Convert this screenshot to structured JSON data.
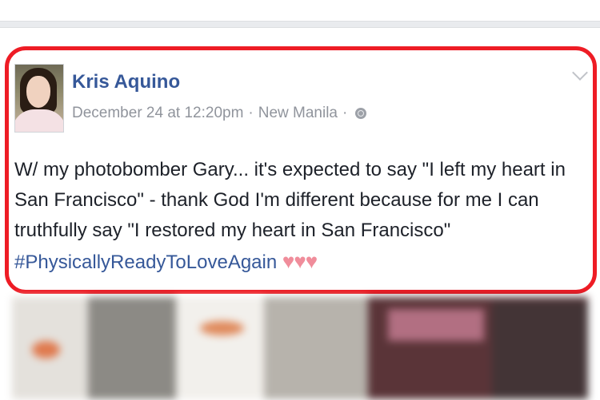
{
  "post": {
    "author": "Kris Aquino",
    "date": "December 24 at 12:20pm",
    "meta_separator": "·",
    "location": "New Manila",
    "privacy_icon": "globe-icon",
    "text": "W/ my photobomber Gary... it's expected to say \"I left my heart in San Francisco\" - thank God I'm different because for me I can truthfully say \"I restored my heart in San Francisco\"",
    "hashtag": "#PhysicallyReadyToLoveAgain",
    "hearts": "♥♥♥"
  },
  "colors": {
    "highlight_border": "#ee1c25",
    "author_link": "#365899",
    "meta_text": "#90949c",
    "body_text": "#1d2129",
    "heart": "#f08d9b"
  }
}
